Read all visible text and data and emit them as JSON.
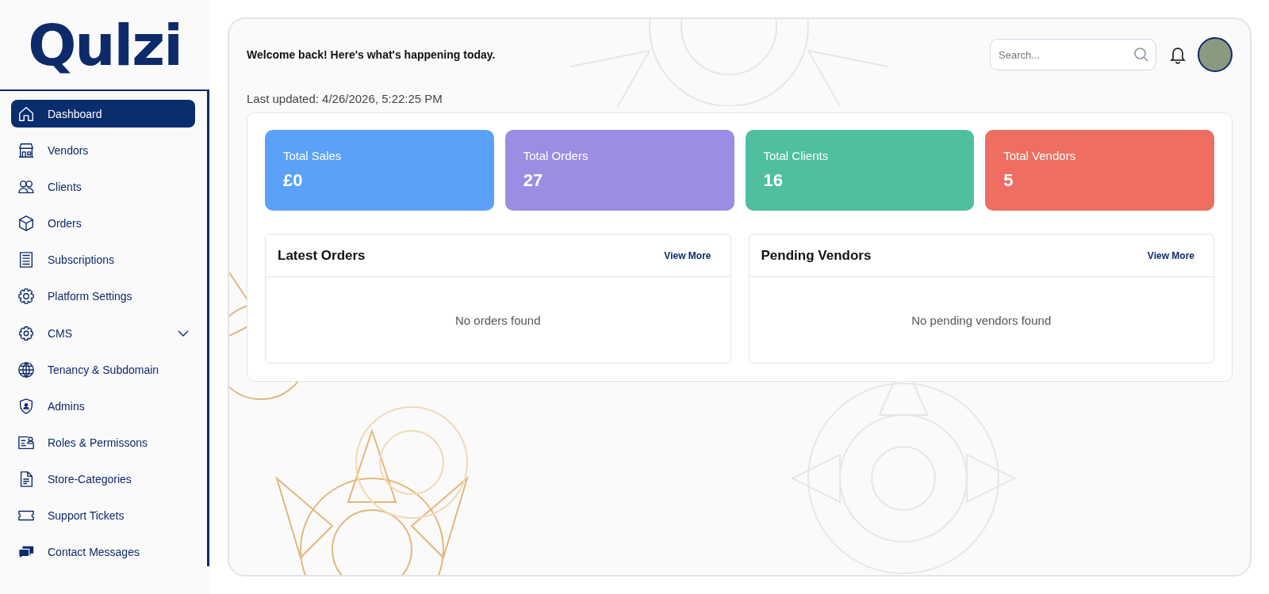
{
  "sidebar": {
    "logo": "Qulzi",
    "items": [
      {
        "label": "Dashboard",
        "selected": true
      },
      {
        "label": "Vendors",
        "selected": false
      },
      {
        "label": "Clients",
        "selected": false
      },
      {
        "label": "Orders",
        "selected": false
      },
      {
        "label": "Subscriptions",
        "selected": false
      },
      {
        "label": "Platform Settings",
        "selected": false
      },
      {
        "label": "CMS",
        "selected": false,
        "expanded": false
      },
      {
        "label": "Tenancy & Subdomain",
        "selected": false
      },
      {
        "label": "Admins",
        "selected": false
      },
      {
        "label": "Roles & Permissons",
        "selected": false
      },
      {
        "label": "Store-Categories",
        "selected": false
      },
      {
        "label": "Support Tickets",
        "selected": false
      },
      {
        "label": "Contact Messages",
        "selected": false
      }
    ]
  },
  "header": {
    "welcome": "Welcome back! Here's what's happening today.",
    "search": {
      "placeholder": "Search..."
    },
    "last_updated": "Last updated: 4/26/2026, 5:22:25 PM"
  },
  "stats": [
    {
      "label": "Total Sales",
      "value": "£0",
      "color": "#5ba1f9"
    },
    {
      "label": "Total Orders",
      "value": "27",
      "color": "#9d8ce3"
    },
    {
      "label": "Total Clients",
      "value": "16",
      "color": "#4fbf9f"
    },
    {
      "label": "Total Vendors",
      "value": "5",
      "color": "#ee6e62"
    }
  ],
  "panels": [
    {
      "title": "Latest Orders",
      "action": "View More",
      "empty": "No orders found"
    },
    {
      "title": "Pending Vendors",
      "action": "View More",
      "empty": "No pending vendors found"
    }
  ]
}
